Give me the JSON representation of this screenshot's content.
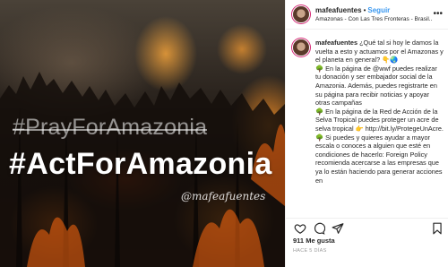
{
  "image": {
    "hashtag_secondary": "#PrayForAmazonia",
    "hashtag_primary": "#ActForAmazonia",
    "watermark": "@mafeafuentes"
  },
  "header": {
    "username": "mafeafuentes",
    "separator": "•",
    "follow_label": "Seguir",
    "location": "Amazonas - Con Las Tres Fronteras - Brasil...",
    "more_icon": "more-horizontal-icon"
  },
  "caption": {
    "username": "mafeafuentes",
    "paragraphs": [
      "¿Qué tal si hoy le damos la vuelta a esto y actuamos por el Amazonas y el planeta en general? 👇🌏",
      "🌳 En la página de @wwf puedes realizar tu donación y ser embajador social de la Amazonia. Además, puedes registrarte en su página para recibir noticias y apoyar otras campañas",
      "🌳 En la página de la Red de Acción de la Selva Tropical puedes proteger un acre de selva tropical 👉 http://bit.ly/ProtegeUnAcre.",
      "🌳 Si puedes y quieres ayudar a mayor escala o conoces a alguien que esté en condiciones de hacerlo: Foreign Policy recomienda acercarse a las empresas que ya lo están haciendo para generar acciones en"
    ]
  },
  "actions": {
    "like_icon": "heart-icon",
    "comment_icon": "comment-icon",
    "share_icon": "share-icon",
    "save_icon": "bookmark-icon"
  },
  "likes": {
    "count": "911",
    "label": "Me gusta"
  },
  "date": "HACE 5 DÍAS"
}
